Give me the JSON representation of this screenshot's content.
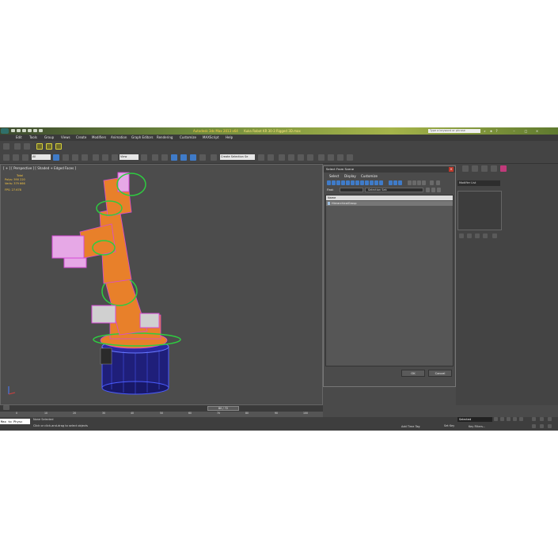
{
  "app": {
    "title": "Autodesk 3ds Max 2013 x64",
    "filename": "Kuka Robot KR 30-3 Rigged 3D.max",
    "search_placeholder": "Type a keyword or phrase"
  },
  "menu": [
    "Edit",
    "Tools",
    "Group",
    "Views",
    "Create",
    "Modifiers",
    "Animation",
    "Graph Editors",
    "Rendering",
    "Customize",
    "MAXScript",
    "Help"
  ],
  "toolbar": {
    "filter_value": "All",
    "view_value": "View",
    "selection_set_placeholder": "Create Selection Se"
  },
  "viewport": {
    "label": "[ + ] [ Perspective ] [ Shaded + Edged Faces ]",
    "stats": {
      "header": "Total",
      "polys_label": "Polys:",
      "polys_value": "590 220",
      "verts_label": "Verts:",
      "verts_value": "379 666",
      "fps_label": "FPS:",
      "fps_value": "27.678"
    }
  },
  "dialog": {
    "title": "Select From Scene",
    "menu": [
      "Select",
      "Display",
      "Customize"
    ],
    "find_label": "Find:",
    "selection_set_label": "Selection Set:",
    "column_name": "Name",
    "rows": [
      "HierarchicalGroup"
    ],
    "ok_label": "OK",
    "cancel_label": "Cancel"
  },
  "right_panel": {
    "modifier_list": "Modifier List"
  },
  "timeline": {
    "frame_display": "80 / 72",
    "ticks": [
      "0",
      "10",
      "20",
      "30",
      "40",
      "50",
      "60",
      "70",
      "80",
      "90",
      "100"
    ]
  },
  "status": {
    "maxscript_text": "Max to Physc",
    "selection_text": "None Selected",
    "prompt_text": "Click or click-and-drag to select objects",
    "add_time_tag": "Add Time Tag",
    "set_key": "Set Key",
    "key_filters": "Key Filters...",
    "selected_dd": "Selected"
  },
  "colors": {
    "accent_yellow": "#f5c542",
    "robot_orange": "#e8802a",
    "wire_magenta": "#d64ad6",
    "gizmo_green": "#2ecc40",
    "base_blue": "#2a2aa0"
  }
}
